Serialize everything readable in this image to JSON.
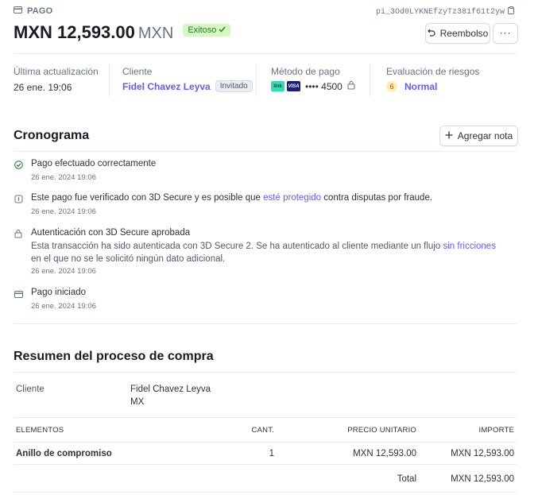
{
  "header": {
    "section_label": "PAGO",
    "payment_id": "pi_3Od0LYKNEfzyTz381f61t2yw",
    "amount": "MXN 12,593.00",
    "currency": "MXN",
    "status": "Exitoso",
    "refund_label": "Reembolso",
    "more_label": "···"
  },
  "meta": {
    "updated_label": "Última actualización",
    "updated_value": "26 ene. 19:06",
    "customer_label": "Cliente",
    "customer_name": "Fidel Chavez Leyva",
    "customer_badge": "Invitado",
    "method_label": "Método de pago",
    "link_brand": "link",
    "visa_brand": "VISA",
    "card_last4": "•••• 4500",
    "risk_label": "Evaluación de riesgos",
    "risk_score": "6",
    "risk_value": "Normal"
  },
  "timeline": {
    "title": "Cronograma",
    "add_note_label": "Agregar nota",
    "events": [
      {
        "title": "Pago efectuado correctamente",
        "time": "26 ene. 2024 19:06"
      },
      {
        "title_pre": "Este pago fue verificado con 3D Secure y es posible que ",
        "title_link": "esté protegido",
        "title_post": " contra disputas por fraude.",
        "time": "26 ene. 2024 19:06"
      },
      {
        "title": "Autenticación con 3D Secure aprobada",
        "body_pre": "Esta transacción ha sido autenticada con 3D Secure 2. Se ha autenticado al cliente mediante un flujo ",
        "body_link": "sin fricciones",
        "body_post": " en el que no se le solicitó ningún dato adicional.",
        "time": "26 ene. 2024 19:06"
      },
      {
        "title": "Pago iniciado",
        "time": "26 ene. 2024 19:06"
      }
    ]
  },
  "summary": {
    "title": "Resumen del proceso de compra",
    "customer_label": "Cliente",
    "customer_name": "Fidel Chavez Leyva",
    "customer_country": "MX",
    "columns": [
      "ELEMENTOS",
      "CANT.",
      "PRECIO UNITARIO",
      "IMPORTE"
    ],
    "rows": [
      {
        "item": "Anillo de compromiso",
        "qty": "1",
        "unit_price": "MXN 12,593.00",
        "amount": "MXN 12,593.00"
      }
    ],
    "total_label": "Total",
    "total_value": "MXN 12,593.00"
  },
  "colors": {
    "accent": "#635bff",
    "success_bg": "#d7f7c2",
    "success_text": "#1d7d2d"
  },
  "icons": [
    "card-icon",
    "copy-icon",
    "check-icon",
    "refund-arrow-icon",
    "plus-icon",
    "check-circle-icon",
    "shield-info-icon",
    "lock-icon",
    "card-icon"
  ]
}
